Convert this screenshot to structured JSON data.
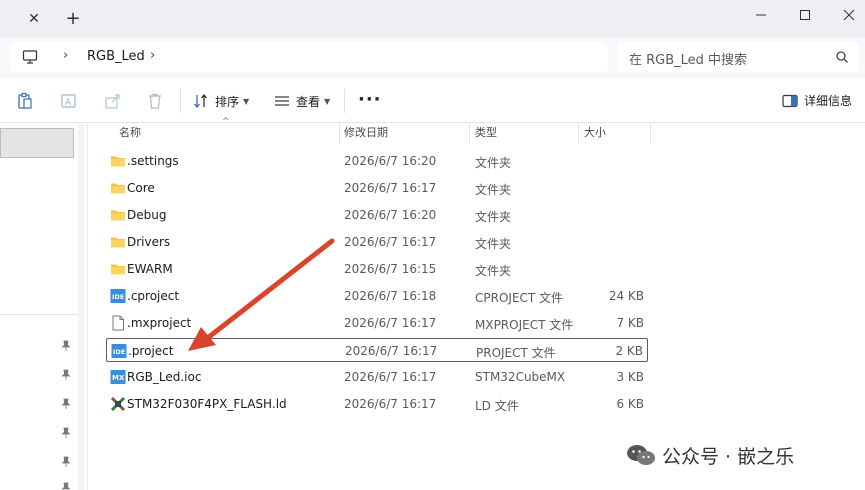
{
  "titlebar": {
    "window_controls": {
      "minimize": "minimize-icon",
      "maximize": "maximize-icon",
      "close": "close-icon"
    }
  },
  "address": {
    "crumb": "RGB_Led",
    "search_placeholder": "在 RGB_Led 中搜索"
  },
  "toolbar": {
    "sort_label": "排序",
    "view_label": "查看",
    "details_label": "详细信息"
  },
  "columns": {
    "name": "名称",
    "date": "修改日期",
    "type": "类型",
    "size": "大小"
  },
  "files": [
    {
      "name": ".settings",
      "date": "2026/6/7 16:20",
      "type": "文件夹",
      "size": "",
      "icon": "folder-icon"
    },
    {
      "name": "Core",
      "date": "2026/6/7 16:17",
      "type": "文件夹",
      "size": "",
      "icon": "folder-icon"
    },
    {
      "name": "Debug",
      "date": "2026/6/7 16:20",
      "type": "文件夹",
      "size": "",
      "icon": "folder-icon"
    },
    {
      "name": "Drivers",
      "date": "2026/6/7 16:17",
      "type": "文件夹",
      "size": "",
      "icon": "folder-icon"
    },
    {
      "name": "EWARM",
      "date": "2026/6/7 16:15",
      "type": "文件夹",
      "size": "",
      "icon": "folder-icon"
    },
    {
      "name": ".cproject",
      "date": "2026/6/7 16:18",
      "type": "CPROJECT 文件",
      "size": "24 KB",
      "icon": "ide-file-icon"
    },
    {
      "name": ".mxproject",
      "date": "2026/6/7 16:17",
      "type": "MXPROJECT 文件",
      "size": "7 KB",
      "icon": "blank-file-icon"
    },
    {
      "name": ".project",
      "date": "2026/6/7 16:17",
      "type": "PROJECT 文件",
      "size": "2 KB",
      "icon": "ide-file-icon",
      "selected": true
    },
    {
      "name": "RGB_Led.ioc",
      "date": "2026/6/7 16:17",
      "type": "STM32CubeMX",
      "size": "3 KB",
      "icon": "mx-file-icon"
    },
    {
      "name": "STM32F030F4PX_FLASH.ld",
      "date": "2026/6/7 16:17",
      "type": "LD 文件",
      "size": "6 KB",
      "icon": "ld-file-icon"
    }
  ],
  "annotation": {
    "arrow_color": "#d9442b"
  },
  "watermark": {
    "text": "公众号 · 嵌之乐"
  },
  "colors": {
    "folder": "#f5c242",
    "ide_badge": "#3a8fd8",
    "selection_border": "#5c5c5c"
  }
}
